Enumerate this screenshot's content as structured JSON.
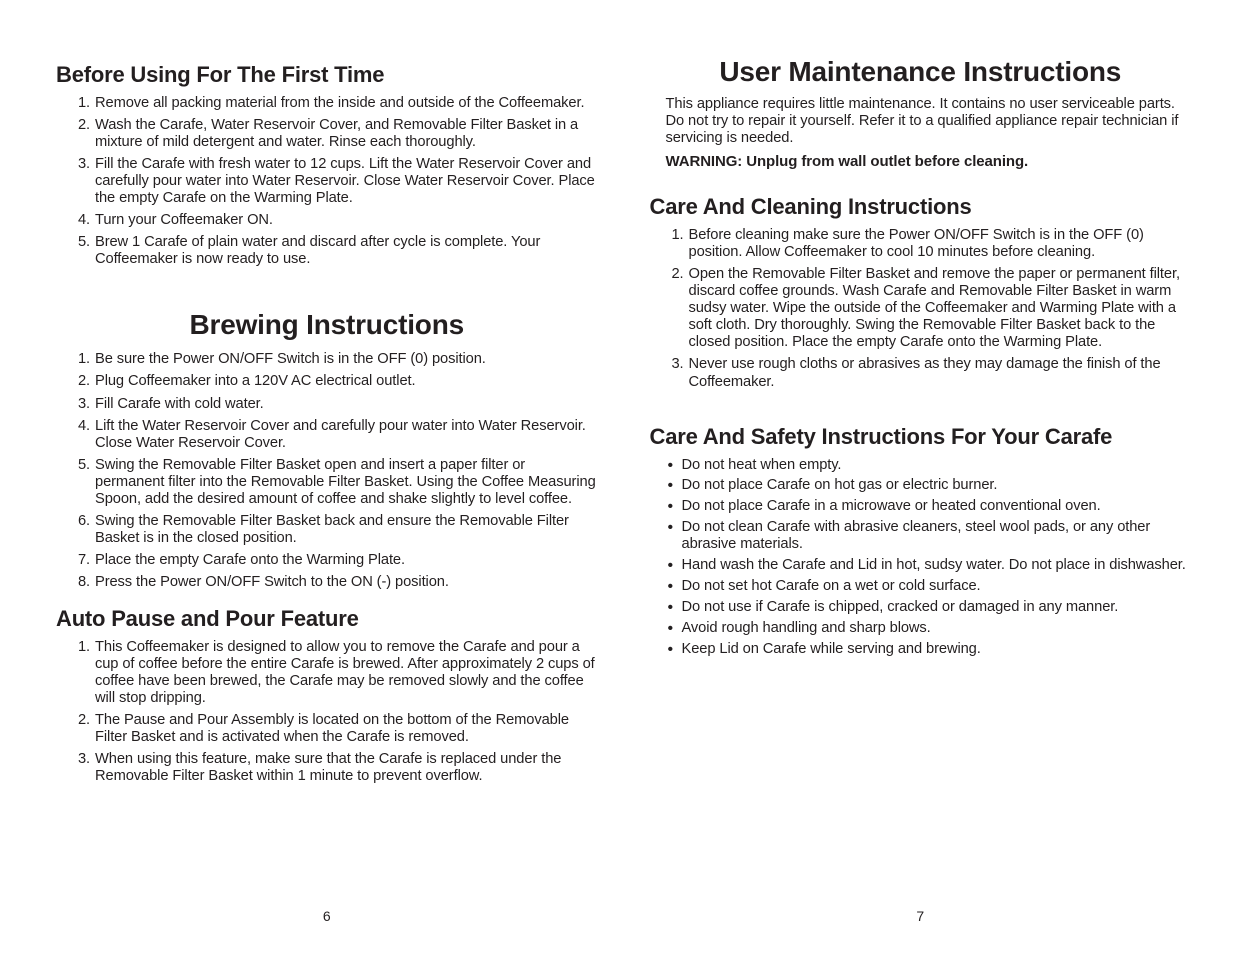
{
  "left": {
    "section1_title": "Before Using For The First Time",
    "section1_items": [
      "Remove all packing material from the inside and outside of the Coffeemaker.",
      "Wash the Carafe, Water Reservoir Cover, and Removable Filter Basket in a mixture of mild detergent and water. Rinse each thoroughly.",
      "Fill the Carafe with fresh water to 12 cups. Lift the Water Reservoir Cover and carefully pour water into Water Reservoir. Close Water Reservoir Cover. Place the empty Carafe on the Warming Plate.",
      "Turn your Coffeemaker ON.",
      "Brew 1 Carafe of plain water and discard after cycle is complete. Your Coffeemaker is now ready to use."
    ],
    "section2_title": "Brewing Instructions",
    "section2_items": [
      "Be sure the Power ON/OFF Switch is in the OFF (0) position.",
      "Plug Coffeemaker into a 120V AC electrical outlet.",
      "Fill Carafe with cold water.",
      "Lift the Water Reservoir Cover and carefully pour water into Water Reservoir. Close Water Reservoir Cover.",
      "Swing the Removable Filter Basket open and insert a paper filter or permanent filter into the Removable Filter Basket. Using the Coffee Measuring Spoon, add the desired amount of coffee and shake slightly to level coffee.",
      "Swing the Removable Filter Basket back and ensure the Removable Filter Basket is in the closed position.",
      "Place the empty Carafe onto the Warming Plate.",
      "Press the Power ON/OFF Switch to the ON (-) position."
    ],
    "section3_title": "Auto Pause and Pour Feature",
    "section3_items": [
      "This Coffeemaker is designed to allow you to remove the Carafe and pour a cup of coffee before the entire Carafe is brewed. After approximately 2 cups of coffee have been brewed, the Carafe may be removed slowly and the coffee will stop dripping.",
      "The Pause and Pour Assembly is located on the bottom of the Removable Filter Basket and is activated when the Carafe is removed.",
      "When using this feature, make sure that the Carafe is replaced under the Removable Filter Basket within 1 minute to prevent overflow."
    ],
    "page_number": "6"
  },
  "right": {
    "section1_title": "User Maintenance Instructions",
    "intro": "This appliance requires little maintenance. It contains no user serviceable parts. Do not try to repair it yourself. Refer it to a qualified appliance repair technician if servicing is needed.",
    "warning": "WARNING: Unplug from wall outlet before cleaning.",
    "section2_title": "Care And Cleaning Instructions",
    "section2_items": [
      "Before cleaning make sure the Power ON/OFF Switch is in the OFF (0) position. Allow Coffeemaker to cool 10 minutes before cleaning.",
      "Open the Removable Filter Basket and remove the paper or permanent filter, discard coffee grounds. Wash Carafe and Removable Filter Basket in warm sudsy water. Wipe the outside of the Coffeemaker and Warming Plate with a soft cloth. Dry thoroughly. Swing the Removable Filter Basket back to the closed position. Place the empty Carafe onto the Warming Plate.",
      "Never use rough cloths or abrasives as they may damage the finish of the Coffeemaker."
    ],
    "section3_title": "Care And Safety Instructions For Your Carafe",
    "section3_items": [
      "Do not heat when empty.",
      "Do not place Carafe on hot gas or electric burner.",
      "Do not place Carafe in a microwave or heated conventional oven.",
      "Do not clean Carafe with abrasive cleaners, steel wool pads, or any other abrasive materials.",
      "Hand wash the Carafe and Lid in hot, sudsy water. Do not place in dishwasher.",
      "Do not set hot Carafe on a wet or cold surface.",
      "Do not use if Carafe is chipped, cracked or damaged in any manner.",
      "Avoid rough handling and sharp blows.",
      "Keep Lid on Carafe while serving and brewing."
    ],
    "page_number": "7"
  }
}
